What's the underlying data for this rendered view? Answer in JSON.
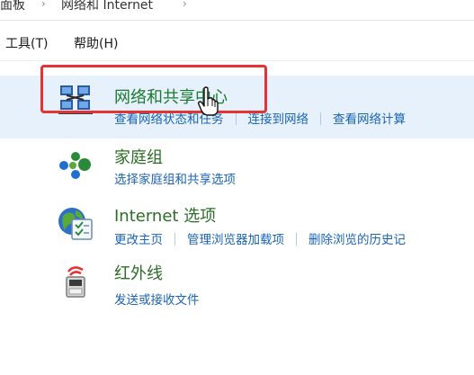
{
  "breadcrumb": {
    "items": [
      "面板",
      "网络和 Internet"
    ]
  },
  "menubar": {
    "items": [
      "工具(T)",
      "帮助(H)"
    ]
  },
  "categories": [
    {
      "title": "网络和共享中心",
      "icon": "network-sharing-icon",
      "links": [
        "查看网络状态和任务",
        "连接到网络",
        "查看网络计算"
      ]
    },
    {
      "title": "家庭组",
      "icon": "homegroup-icon",
      "links": [
        "选择家庭组和共享选项"
      ]
    },
    {
      "title": "Internet 选项",
      "icon": "internet-options-icon",
      "links": [
        "更改主页",
        "管理浏览器加载项",
        "删除浏览的历史记"
      ]
    },
    {
      "title": "红外线",
      "icon": "infrared-icon",
      "links": [
        "发送或接收文件"
      ]
    }
  ],
  "colors": {
    "title_green": "#1a7a2f",
    "link_blue": "#1b64b5",
    "highlight_red": "#e53232",
    "selected_row_bg": "#e6f1fb"
  }
}
